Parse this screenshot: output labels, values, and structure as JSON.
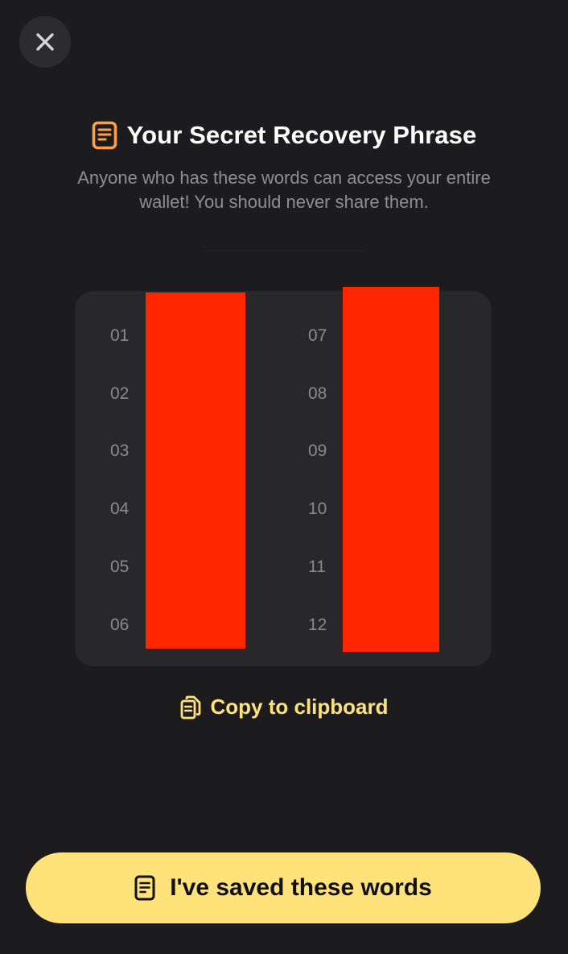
{
  "header": {
    "close_icon": "close-icon"
  },
  "title": {
    "text": "Your Secret Recovery Phrase",
    "icon": "document-icon",
    "icon_color": "#ff9f43"
  },
  "subtitle": {
    "line1": "Anyone who has these words can access your entire",
    "line2": "wallet! You should never share them."
  },
  "phrase": {
    "left_numbers": [
      "01",
      "02",
      "03",
      "04",
      "05",
      "06"
    ],
    "right_numbers": [
      "07",
      "08",
      "09",
      "10",
      "11",
      "12"
    ],
    "redaction_color": "#ff2600"
  },
  "copy": {
    "label": "Copy to clipboard",
    "icon": "copy-icon",
    "color": "#ffe27a"
  },
  "footer": {
    "saved_label": "I've saved these words",
    "icon": "document-icon",
    "button_color": "#ffe27a"
  }
}
